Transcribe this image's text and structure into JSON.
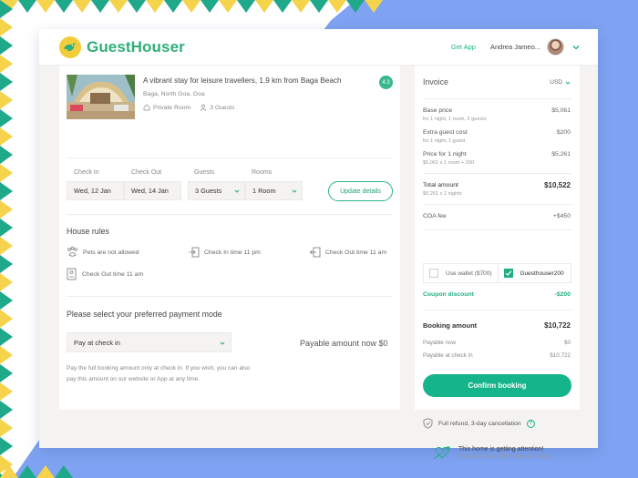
{
  "brand": {
    "name": "GuestHouser",
    "logo_color": "#f2cd3b",
    "accent": "#1fae84"
  },
  "header": {
    "get_app": "Get App",
    "user_name": "Andrea Jameo...",
    "icons": [
      "bird-logo-icon",
      "avatar",
      "chevron-down-icon"
    ]
  },
  "listing": {
    "title": "A vibrant stay for leisure travellers, 1.9 km from Baga Beach",
    "location": "Baga, North Goa, Goa",
    "room_type": "Private Room",
    "guests": "3 Guests",
    "rating": "4.3"
  },
  "booking_fields": {
    "check_in_label": "Check In",
    "check_in_value": "Wed, 12 Jan",
    "check_out_label": "Check Out",
    "check_out_value": "Wed, 14 Jan",
    "guests_label": "Guests",
    "guests_value": "3 Guests",
    "rooms_label": "Rooms",
    "rooms_value": "1 Room",
    "update_button": "Update details"
  },
  "house_rules": {
    "title": "House rules",
    "items": [
      "Pets are not allowed",
      "Check In time 11 pm",
      "Check Out time 11 am",
      "Check Out time 11 am"
    ]
  },
  "payment": {
    "title": "Please select your preferred payment mode",
    "selected_mode": "Pay at check in",
    "payable_now": "Payable amount now $0",
    "note": "Pay the full booking amount only at check in. If you wish, you can also pay this amount on our website or App at any time."
  },
  "invoice": {
    "title": "Invoice",
    "currency": "USD",
    "lines": [
      {
        "label": "Base price",
        "sub": "for 1 night, 1 room, 2 guests",
        "value": "$5,061"
      },
      {
        "label": "Extra guest cost",
        "sub": "for 1 night, 1 guest",
        "value": "$200"
      },
      {
        "label": "Price for 1 night",
        "sub": "$5,061 x 1 room + 200",
        "value": "$5,261"
      }
    ],
    "total_label": "Total amount",
    "total_sub": "$5,261 x 2 nights",
    "total_value": "$10,522",
    "coa_label": "COA fee",
    "coa_value": "+$450",
    "wallet_label": "Use wallet ($700)",
    "coupon_code": "Guesthouser200",
    "coupon_label": "Coupon discount",
    "coupon_value": "-$200",
    "booking_label": "Booking amount",
    "booking_value": "$10,722",
    "payable_now_label": "Payable now",
    "payable_now_value": "$0",
    "payable_checkin_label": "Payable at check in",
    "payable_checkin_value": "$10,722",
    "confirm_button": "Confirm booking"
  },
  "footer": {
    "refund_text": "Full refund, 3-day cancellation",
    "help_mark": "?",
    "attention_title": "This home is getting attention!",
    "attention_sub": "It's been viewed 100+ times in 6 days."
  }
}
